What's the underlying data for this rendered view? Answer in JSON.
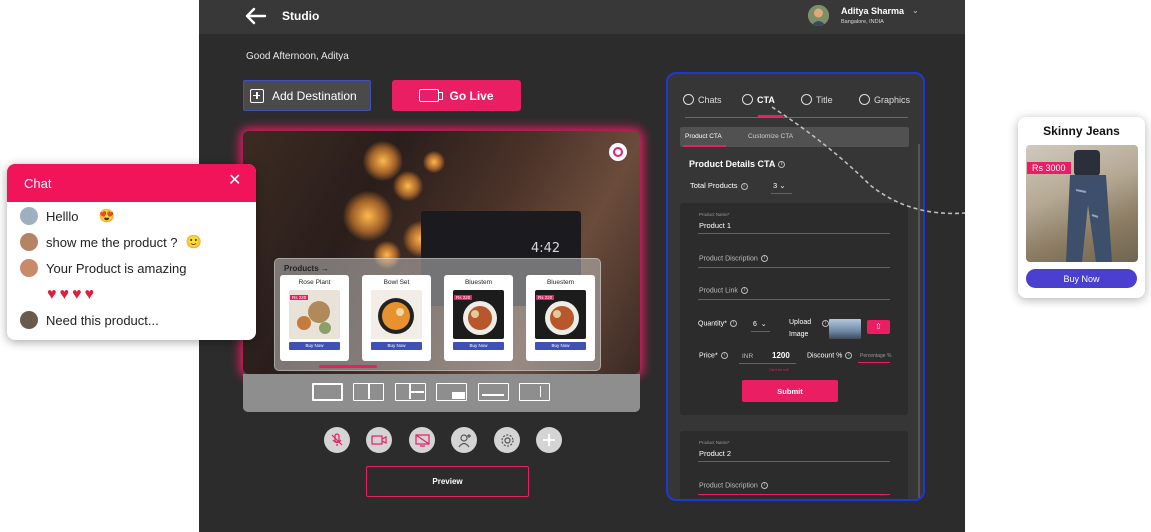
{
  "topbar": {
    "title": "Studio",
    "user_name": "Aditya Sharma",
    "user_location": "Bangalore, INDIA"
  },
  "greeting": "Good Afternoon, Aditya",
  "actions": {
    "add_destination": "Add Destination",
    "go_live": "Go Live"
  },
  "video": {
    "timer": "4:42",
    "products_title": "Products →",
    "products": [
      {
        "name": "Rose Plant",
        "price": "Rs 220",
        "buy": "Buy Now"
      },
      {
        "name": "Bowl Set",
        "price": "Rs 220",
        "buy": "Buy Now"
      },
      {
        "name": "Bluestem",
        "price": "Rs 220",
        "buy": "Buy Now"
      },
      {
        "name": "Bluestem",
        "price": "Rs 220",
        "buy": "Buy Now"
      }
    ]
  },
  "preview_label": "Preview",
  "panel": {
    "tabs": [
      {
        "label": "Chats",
        "icon": "chat-bubble-icon"
      },
      {
        "label": "CTA",
        "icon": "cta-icon"
      },
      {
        "label": "Title",
        "icon": "title-icon"
      },
      {
        "label": "Graphics",
        "icon": "graphics-icon"
      }
    ],
    "subtabs": [
      "Product CTA",
      "Customize CTA"
    ],
    "section_title": "Product Details CTA",
    "total_products_label": "Total Products",
    "total_products_value": "3",
    "form1": {
      "name_label": "Product Name*",
      "name_value": "Product 1",
      "desc_placeholder": "Product Discription",
      "link_placeholder": "Product Link",
      "quantity_label": "Quantity*",
      "quantity_value": "6",
      "upload_label": "Upload Image",
      "price_label": "Price*",
      "currency": "INR",
      "price_value": "1200",
      "discount_label": "Discount %",
      "discount_placeholder": "Percentage %",
      "hint": "Can't be null",
      "submit": "Submit"
    },
    "form2": {
      "name_label": "Product Name*",
      "name_value": "Product 2",
      "desc_placeholder": "Product Discription"
    }
  },
  "chat": {
    "title": "Chat",
    "messages": [
      "Helllo",
      "show me the product ?",
      "Your Product is amazing",
      "Need this product..."
    ],
    "emojis": [
      "😍",
      "🙂"
    ],
    "hearts": "♥♥♥♥"
  },
  "popup": {
    "title": "Skinny Jeans",
    "price": "Rs 3000",
    "buy": "Buy Now"
  },
  "colors": {
    "accent": "#e91e63",
    "panel_border": "#2236d6",
    "buy_button": "#4a3fcf"
  }
}
